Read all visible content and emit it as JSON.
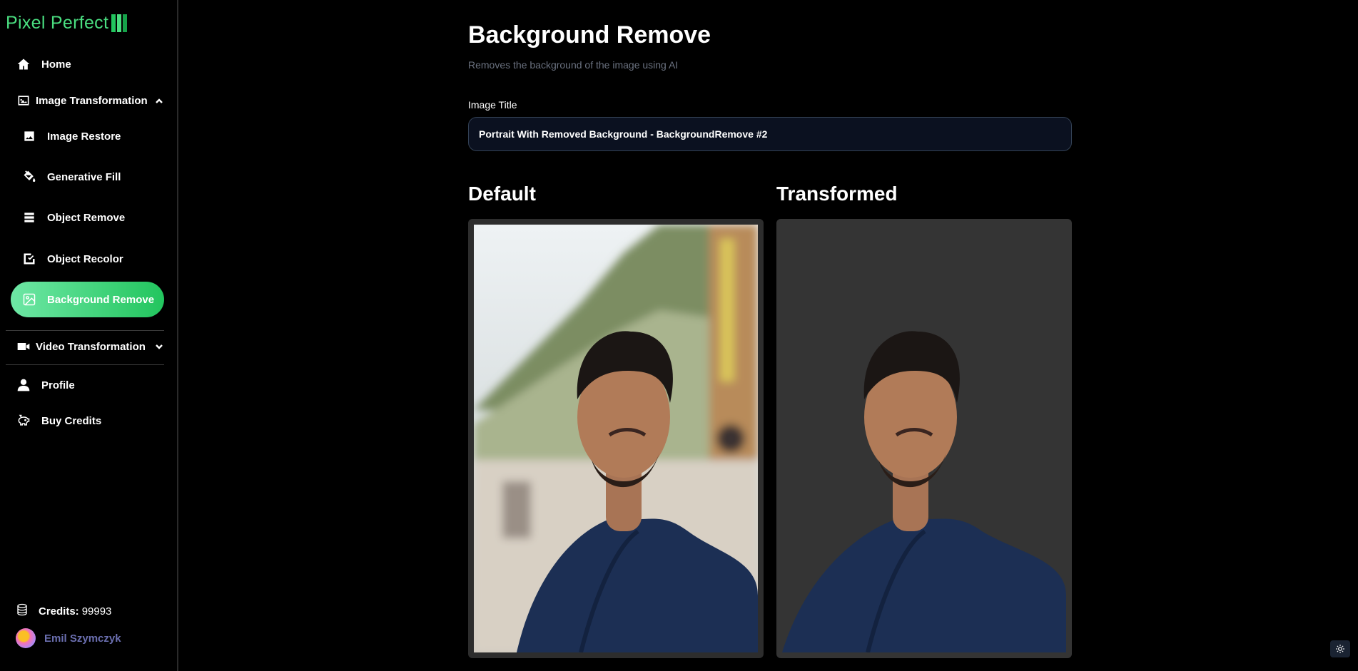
{
  "app": {
    "name": "Pixel Perfect",
    "accent": "#22c55e"
  },
  "sidebar": {
    "home": "Home",
    "image_transformation": "Image Transformation",
    "items": [
      {
        "label": "Image Restore",
        "icon": "image-icon"
      },
      {
        "label": "Generative Fill",
        "icon": "paint-bucket-icon"
      },
      {
        "label": "Object Remove",
        "icon": "layers-icon"
      },
      {
        "label": "Object Recolor",
        "icon": "recolor-icon"
      },
      {
        "label": "Background Remove",
        "icon": "image-remove-icon",
        "active": true
      }
    ],
    "video_transformation": "Video Transformation",
    "profile": "Profile",
    "buy_credits": "Buy Credits",
    "credits_label": "Credits:",
    "credits_value": "99993",
    "user_name": "Emil Szymczyk"
  },
  "page": {
    "title": "Background Remove",
    "subtitle": "Removes the background of the image using AI",
    "image_title_label": "Image Title",
    "image_title_value": "Portrait With Removed Background - BackgroundRemove #2",
    "default_heading": "Default",
    "transformed_heading": "Transformed"
  }
}
